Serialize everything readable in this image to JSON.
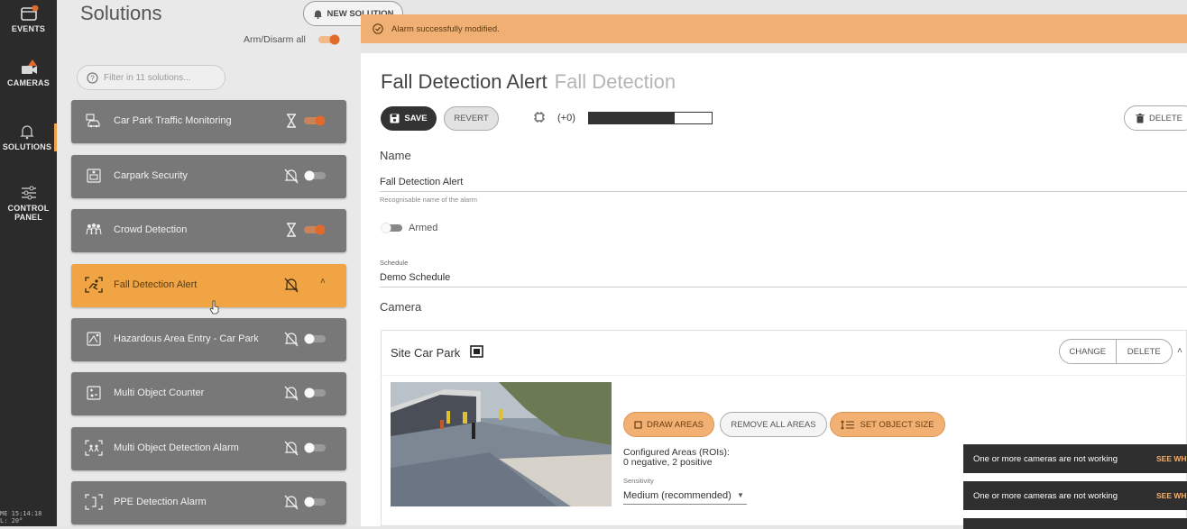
{
  "rail": {
    "items": [
      {
        "label": "EVENTS",
        "icon": "events-icon"
      },
      {
        "label": "CAMERAS",
        "icon": "camera-icon"
      },
      {
        "label": "SOLUTIONS",
        "icon": "bell-icon"
      },
      {
        "label": "CONTROL PANEL",
        "icon": "sliders-icon"
      }
    ],
    "clock_line1": "ME 15:14:18",
    "clock_line2": "L: 20°"
  },
  "solutions": {
    "title": "Solutions",
    "new_button": "NEW SOLUTION",
    "arm_all_label": "Arm/Disarm all",
    "filter_placeholder": "Filter in 11 solutions...",
    "items": [
      {
        "label": "Car Park Traffic Monitoring",
        "state": "hourglass",
        "armed": true
      },
      {
        "label": "Carpark Security",
        "state": "bell-off",
        "armed": false
      },
      {
        "label": "Crowd Detection",
        "state": "hourglass",
        "armed": true
      },
      {
        "label": "Fall Detection Alert",
        "state": "bell-off",
        "armed": false
      },
      {
        "label": "Hazardous Area Entry - Car Park",
        "state": "bell-off",
        "armed": false
      },
      {
        "label": "Multi Object Counter",
        "state": "bell-off",
        "armed": false
      },
      {
        "label": "Multi Object Detection Alarm",
        "state": "bell-off",
        "armed": false
      },
      {
        "label": "PPE Detection Alarm",
        "state": "bell-off",
        "armed": false
      }
    ]
  },
  "banner": {
    "text": "Alarm successfully modified."
  },
  "detail": {
    "title": "Fall Detection Alert",
    "subtitle": "Fall Detection",
    "save_label": "SAVE",
    "revert_label": "REVERT",
    "counter": "(+0)",
    "progress": 0.7,
    "delete_label": "DELETE",
    "name_heading": "Name",
    "name_value": "Fall Detection Alert",
    "name_hint": "Recognisable name of the alarm",
    "armed_label": "Armed",
    "schedule_label": "Schedule",
    "schedule_value": "Demo Schedule",
    "camera_heading": "Camera",
    "camera": {
      "name": "Site Car Park",
      "change_label": "CHANGE",
      "delete_label": "DELETE",
      "draw_areas": "DRAW AREAS",
      "remove_all_areas": "REMOVE ALL AREAS",
      "set_object_size": "SET OBJECT SIZE",
      "configured_line1": "Configured Areas (ROIs):",
      "configured_line2": "0 negative, 2 positive",
      "sensitivity_label": "Sensitivity",
      "sensitivity_value": "Medium (recommended)"
    }
  },
  "toasts": [
    {
      "text": "One or more cameras are not working",
      "action": "SEE WHY"
    },
    {
      "text": "One or more cameras are not working",
      "action": "SEE WHY"
    }
  ],
  "colors": {
    "accent": "#f0a444",
    "toggle_on": "#e06a2c",
    "banner": "#f0b073"
  }
}
